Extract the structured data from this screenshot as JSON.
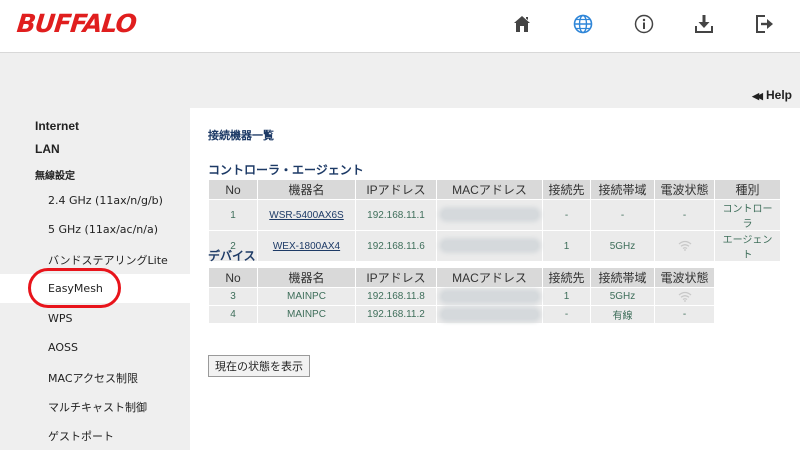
{
  "header": {
    "logo": "BUFFALO",
    "icons": [
      "home-icon",
      "globe-icon",
      "info-icon",
      "download-icon",
      "logout-icon"
    ],
    "accent_active": "#2f86d8"
  },
  "help": {
    "label": "Help"
  },
  "sidebar": {
    "internet": "Internet",
    "lan": "LAN",
    "wireless": "無線設定",
    "items": [
      {
        "label": "2.4 GHz (11ax/n/g/b)"
      },
      {
        "label": "5 GHz (11ax/ac/n/a)"
      },
      {
        "label": "バンドステアリングLite"
      },
      {
        "label": "EasyMesh",
        "active": true
      },
      {
        "label": "WPS"
      },
      {
        "label": "AOSS"
      },
      {
        "label": "MACアクセス制限"
      },
      {
        "label": "マルチキャスト制御"
      },
      {
        "label": "ゲストポート"
      }
    ],
    "highlight_color": "#e8141b"
  },
  "main": {
    "title": "接続機器一覧",
    "controller_section": {
      "title": "コントローラ・エージェント",
      "headers": [
        "No",
        "機器名",
        "IPアドレス",
        "MACアドレス",
        "接続先",
        "接続帯域",
        "電波状態",
        "種別"
      ],
      "rows": [
        {
          "no": "1",
          "name": "WSR-5400AX6S",
          "ip": "192.168.11.1",
          "dest": "-",
          "band": "-",
          "signal": "-",
          "type": "コントローラ"
        },
        {
          "no": "2",
          "name": "WEX-1800AX4",
          "ip": "192.168.11.6",
          "dest": "1",
          "band": "5GHz",
          "signal_icon": "wifi-signal-icon",
          "type": "エージェント"
        }
      ]
    },
    "device_section": {
      "title": "デバイス",
      "headers": [
        "No",
        "機器名",
        "IPアドレス",
        "MACアドレス",
        "接続先",
        "接続帯域",
        "電波状態"
      ],
      "rows": [
        {
          "no": "3",
          "name": "MAINPC",
          "ip": "192.168.11.8",
          "dest": "1",
          "band": "5GHz",
          "signal_icon": "wifi-signal-icon"
        },
        {
          "no": "4",
          "name": "MAINPC",
          "ip": "192.168.11.2",
          "dest": "-",
          "band": "有線",
          "signal": "-"
        }
      ]
    },
    "button_label": "現在の状態を表示"
  }
}
